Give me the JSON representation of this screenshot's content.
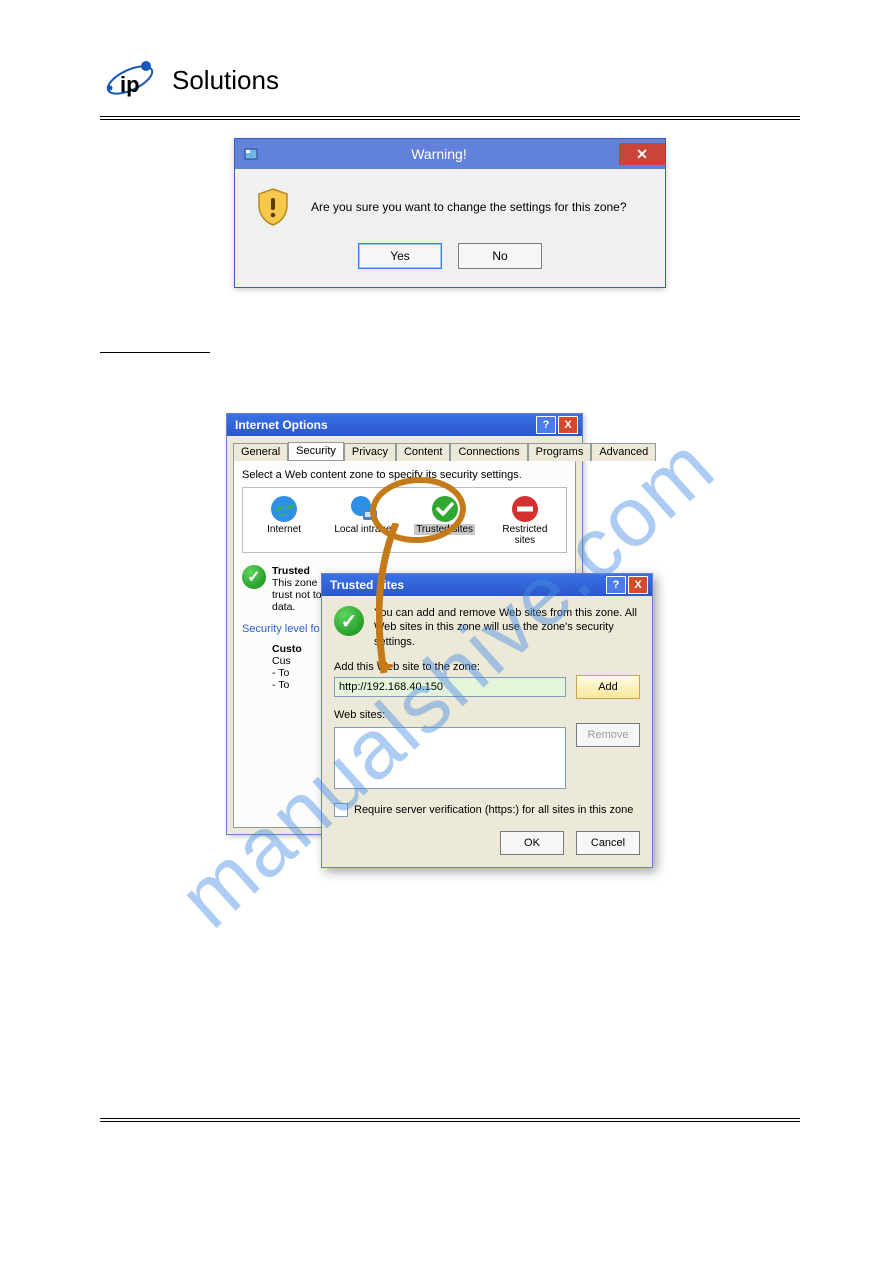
{
  "brand": {
    "name": "Solutions"
  },
  "warning_dialog": {
    "title": "Warning!",
    "message": "Are you sure you want to change the settings for this zone?",
    "yes_label": "Yes",
    "no_label": "No",
    "close_glyph": "✕"
  },
  "internet_options": {
    "title": "Internet Options",
    "help_glyph": "?",
    "close_glyph": "X",
    "tabs": {
      "general": "General",
      "security": "Security",
      "privacy": "Privacy",
      "content": "Content",
      "connections": "Connections",
      "programs": "Programs",
      "advanced": "Advanced"
    },
    "select_zone_text": "Select a Web content zone to specify its security settings.",
    "zones": {
      "internet": "Internet",
      "intranet": "Local intranet",
      "trusted": "Trusted sites",
      "restricted": "Restricted sites"
    },
    "trusted_heading": "Trusted",
    "trusted_desc_1": "This zone",
    "trusted_desc_2": "trust not to",
    "trusted_desc_3": "data.",
    "security_level_label": "Security level fo",
    "custom_heading": "Custo",
    "custom_line1": "Cus",
    "custom_line2": "- To",
    "custom_line3": "- To"
  },
  "trusted_sites": {
    "title": "Trusted sites",
    "help_glyph": "?",
    "close_glyph": "X",
    "intro": "You can add and remove Web sites from this zone. All Web sites in this zone will use the zone's security settings.",
    "add_label": "Add this Web site to the zone:",
    "input_value": "http://192.168.40.150",
    "add_button": "Add",
    "websites_label": "Web sites:",
    "remove_button": "Remove",
    "require_verify": "Require server verification (https:) for all sites in this zone",
    "ok_button": "OK",
    "cancel_button": "Cancel"
  },
  "watermark_text": "manualshive.com"
}
